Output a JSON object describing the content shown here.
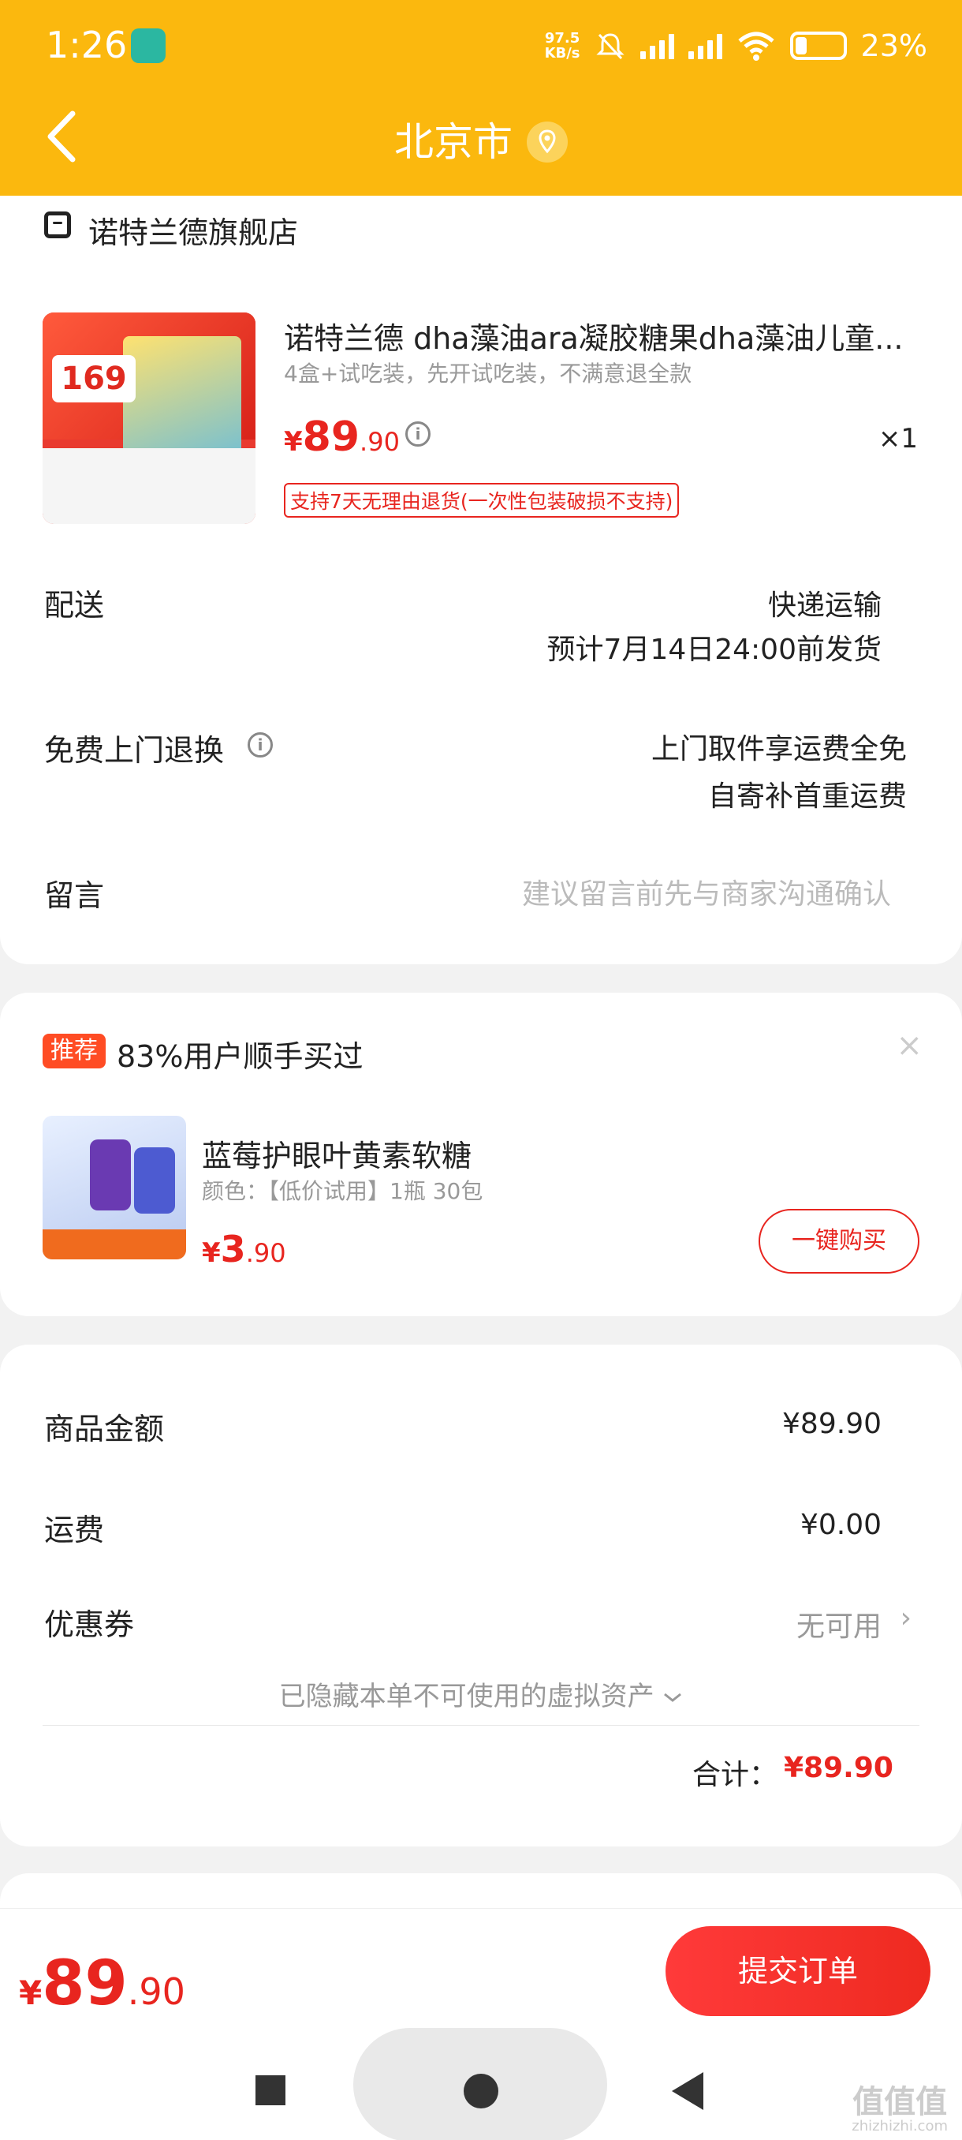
{
  "status_bar": {
    "time": "1:26",
    "speed_value": "97.5",
    "speed_unit": "KB/s",
    "battery": "23%"
  },
  "header": {
    "title": "北京市"
  },
  "order": {
    "store_name": "诺特兰德旗舰店",
    "product": {
      "title": "诺特兰德 dha藻油ara凝胶糖果dha藻油儿童...",
      "spec": "4盒+试吃装，先开试吃装，不满意退全款",
      "price_currency": "¥",
      "price_int": "89",
      "price_dec": ".90",
      "quantity": "×1",
      "return_policy": "支持7天无理由退货(一次性包装破损不支持)",
      "thumb_price": "169"
    },
    "delivery": {
      "label": "配送",
      "method": "快递运输",
      "estimate": "预计7月14日24:00前发货"
    },
    "free_return": {
      "label": "免费上门退换",
      "line1": "上门取件享运费全免",
      "line2": "自寄补首重运费"
    },
    "message": {
      "label": "留言",
      "placeholder": "建议留言前先与商家沟通确认"
    }
  },
  "recommend": {
    "tag": "推荐",
    "title": "83%用户顺手买过",
    "close": "×",
    "item": {
      "name": "蓝莓护眼叶黄素软糖",
      "spec": "颜色：【低价试用】1瓶 30包",
      "price_currency": "¥",
      "price_int": "3",
      "price_dec": ".90",
      "buy_label": "一键购买"
    }
  },
  "summary": {
    "goods_label": "商品金额",
    "goods_value": "¥89.90",
    "shipping_label": "运费",
    "shipping_value": "¥0.00",
    "coupon_label": "优惠券",
    "coupon_value": "无可用",
    "hidden_assets": "已隐藏本单不可使用的虚拟资产",
    "total_label": "合计：",
    "total_value": "¥89.90"
  },
  "bottom_bar": {
    "price_currency": "¥",
    "price_int": "89",
    "price_dec": ".90",
    "submit_label": "提交订单"
  },
  "watermark": {
    "text": "值值值",
    "sub": "zhizhizhi.com"
  },
  "colors": {
    "header": "#fbb80e",
    "accent": "#e8251f",
    "recommend_tag": "#ff4c24"
  },
  "icons": [
    "back-icon",
    "location-icon",
    "store-icon",
    "info-icon",
    "close-icon",
    "chevron-right-icon",
    "chevron-down-icon"
  ]
}
